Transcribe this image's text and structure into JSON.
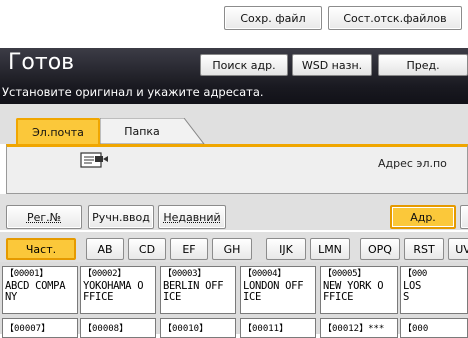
{
  "top_buttons": {
    "stored_file": "Сохр. файл",
    "tx_file_status": "Сост.отск.файлов"
  },
  "status": {
    "title": "Готов",
    "subtitle": "Установите оригинал и укажите адресата."
  },
  "header_buttons": {
    "search_dest": "Поиск адр.",
    "wsd_dest": "WSD назн.",
    "prev": "Пред."
  },
  "tabs": {
    "email": "Эл.почта",
    "folder": "Папка"
  },
  "destination": {
    "label": "Адрес эл.по"
  },
  "row_buttons": {
    "reg_no": "Рег.№",
    "manual": "Ручн.ввод",
    "recent": "Недавний",
    "addr": "Адр."
  },
  "alpha_tabs": [
    "Част.",
    "AB",
    "CD",
    "EF",
    "GH",
    "IJK",
    "LMN",
    "OPQ",
    "RST",
    "UV"
  ],
  "entries": [
    {
      "num": "【00001】",
      "line1": "ABCD COMPA",
      "line2": "NY"
    },
    {
      "num": "【00002】",
      "line1": "YOKOHAMA O",
      "line2": "FFICE"
    },
    {
      "num": "【00003】",
      "line1": "BERLIN OFF",
      "line2": "ICE"
    },
    {
      "num": "【00004】",
      "line1": "LONDON OFF",
      "line2": "ICE"
    },
    {
      "num": "【00005】",
      "line1": "NEW YORK O",
      "line2": "FFICE"
    },
    {
      "num": "【000",
      "line1": "LOS",
      "line2": "S"
    }
  ],
  "entries_row2": [
    "【00007】",
    "【00008】",
    "【00010】",
    "【00011】",
    "【00012】***",
    "【000"
  ],
  "colors": {
    "accent": "#fbc83a",
    "accent_border": "#f0a600",
    "header_bg": "#1c1c22"
  }
}
